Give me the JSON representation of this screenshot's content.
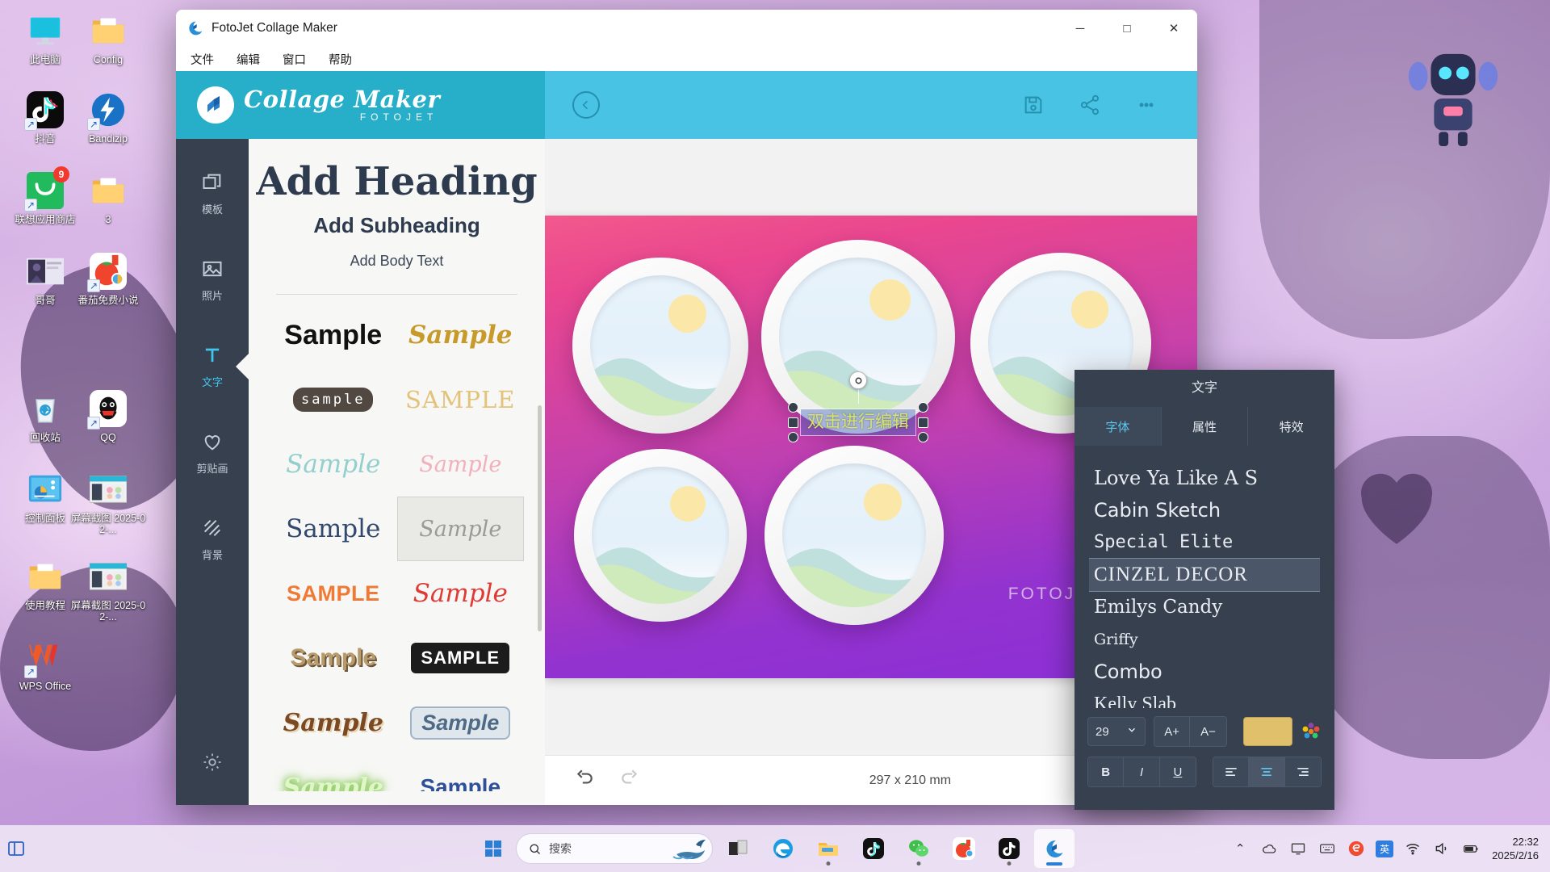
{
  "desktop": {
    "icons": [
      {
        "label": "此电脑",
        "icon": "this-pc-icon",
        "shortcut": false,
        "badge": null
      },
      {
        "label": "Config",
        "icon": "folder-icon",
        "shortcut": false,
        "badge": null
      },
      {
        "label": "抖音",
        "icon": "douyin-icon",
        "shortcut": true,
        "badge": null
      },
      {
        "label": "Bandizip",
        "icon": "bandizip-icon",
        "shortcut": true,
        "badge": null
      },
      {
        "label": "联想应用商店",
        "icon": "lenovo-store-icon",
        "shortcut": true,
        "badge": "9"
      },
      {
        "label": "3",
        "icon": "folder-icon",
        "shortcut": false,
        "badge": null
      },
      {
        "label": "哥哥",
        "icon": "image-thumb-icon",
        "shortcut": false,
        "badge": null
      },
      {
        "label": "番茄免费小说",
        "icon": "tomato-novel-icon",
        "shortcut": true,
        "badge": null
      },
      {
        "label": "回收站",
        "icon": "recycle-bin-icon",
        "shortcut": false,
        "badge": null
      },
      {
        "label": "QQ",
        "icon": "qq-icon",
        "shortcut": true,
        "badge": null
      },
      {
        "label": "控制面板",
        "icon": "control-panel-icon",
        "shortcut": false,
        "badge": null
      },
      {
        "label": "屏幕截图 2025-02-...",
        "icon": "screenshot-thumb-icon",
        "shortcut": false,
        "badge": null
      },
      {
        "label": "使用教程",
        "icon": "folder-icon",
        "shortcut": false,
        "badge": null
      },
      {
        "label": "屏幕截图 2025-02-...",
        "icon": "screenshot-thumb-icon",
        "shortcut": false,
        "badge": null
      },
      {
        "label": "WPS Office",
        "icon": "wps-office-icon",
        "shortcut": true,
        "badge": null
      }
    ]
  },
  "window": {
    "title": "FotoJet Collage Maker",
    "app_icon": "fotojet-icon",
    "controls": {
      "minimize": "─",
      "maximize": "□",
      "close": "✕"
    },
    "menu": [
      "文件",
      "编辑",
      "窗口",
      "帮助"
    ]
  },
  "brand": {
    "name": "Collage Maker",
    "sub": "FOTOJET",
    "bg_color": "#27afca"
  },
  "rail": {
    "items": [
      {
        "label": "模板",
        "icon": "templates-icon",
        "active": false
      },
      {
        "label": "照片",
        "icon": "photos-icon",
        "active": false
      },
      {
        "label": "文字",
        "icon": "text-icon",
        "active": true
      },
      {
        "label": "剪贴画",
        "icon": "clipart-heart-icon",
        "active": false
      },
      {
        "label": "背景",
        "icon": "background-icon",
        "active": false
      }
    ],
    "settings_icon": "gear-icon"
  },
  "text_panel": {
    "heading": "Add Heading",
    "subheading": "Add Subheading",
    "body": "Add Body Text",
    "samples": [
      {
        "text": "Sample",
        "style": "s-bold",
        "selected": false
      },
      {
        "text": "Sample",
        "style": "s-goldit",
        "selected": false
      },
      {
        "text": "sample",
        "style": "s-bub",
        "selected": false
      },
      {
        "text": "SAMPLE",
        "style": "s-caps",
        "selected": false
      },
      {
        "text": "Sample",
        "style": "s-mint",
        "selected": false
      },
      {
        "text": "Sample",
        "style": "s-pink",
        "selected": false
      },
      {
        "text": "Sample",
        "style": "s-navy",
        "selected": false
      },
      {
        "text": "Sample",
        "style": "s-thin",
        "selected": true
      },
      {
        "text": "SAMPLE",
        "style": "s-orange",
        "selected": false
      },
      {
        "text": "Sample",
        "style": "s-red",
        "selected": false
      },
      {
        "text": "Sample",
        "style": "s-3d",
        "selected": false
      },
      {
        "text": "SAMPLE",
        "style": "s-blk",
        "selected": false
      },
      {
        "text": "Sample",
        "style": "s-brown",
        "selected": false
      },
      {
        "text": "Sample",
        "style": "s-steel",
        "selected": false
      },
      {
        "text": "Sample",
        "style": "s-glow",
        "selected": false
      },
      {
        "text": "Sample",
        "style": "s-blue",
        "selected": false
      }
    ]
  },
  "editor": {
    "toolbar": {
      "back_icon": "back-chevron-icon",
      "save_icon": "save-floppy-icon",
      "share_icon": "share-icon",
      "more_icon": "more-dots-icon",
      "bg_color": "#49c3e4"
    },
    "canvas": {
      "watermark": "FOTOJET",
      "gradient_from": "#f2598c",
      "gradient_to": "#8b2fd6",
      "selected_text": "双击进行编辑"
    },
    "bottom": {
      "undo_icon": "undo-icon",
      "redo_icon": "redo-icon",
      "dimensions": "297 x 210 mm",
      "add_icon": "plus-icon"
    }
  },
  "float_panel": {
    "title": "文字",
    "tabs": [
      {
        "label": "字体",
        "active": true
      },
      {
        "label": "属性",
        "active": false
      },
      {
        "label": "特效",
        "active": false
      }
    ],
    "fonts": [
      {
        "name": "Love Ya Like A S",
        "selected": false
      },
      {
        "name": "Cabin Sketch",
        "selected": false
      },
      {
        "name": "Special Elite",
        "selected": false
      },
      {
        "name": "CINZEL DECOR",
        "selected": true
      },
      {
        "name": "Emilys Candy",
        "selected": false
      },
      {
        "name": "Griffy",
        "selected": false
      },
      {
        "name": "Combo",
        "selected": false
      },
      {
        "name": "Kelly Slab",
        "selected": false
      }
    ],
    "controls": {
      "font_size": "29",
      "chevron": "⌄",
      "increase": "A+",
      "decrease": "A−",
      "color_hex": "#e0c06a",
      "bold": "B",
      "italic": "I",
      "underline": "U",
      "align_left": "align-left-icon",
      "align_center": "align-center-icon",
      "align_right": "align-right-icon",
      "active_align": "center"
    }
  },
  "taskbar": {
    "search_placeholder": "搜索",
    "search_icon": "search-icon",
    "start_icon": "windows-start-icon",
    "apps": [
      {
        "name": "task-view",
        "running": false,
        "active": false
      },
      {
        "name": "edge",
        "running": false,
        "active": false
      },
      {
        "name": "file-explorer",
        "running": true,
        "active": false
      },
      {
        "name": "douyin",
        "running": false,
        "active": false
      },
      {
        "name": "wechat",
        "running": true,
        "active": false
      },
      {
        "name": "tomato-novel",
        "running": false,
        "active": false
      },
      {
        "name": "tiktok",
        "running": true,
        "active": false
      },
      {
        "name": "fotojet",
        "running": false,
        "active": true
      }
    ],
    "tray": {
      "chevron": "⌃",
      "ime": "英",
      "items": [
        "onedrive-icon",
        "display-icon",
        "keyboard-icon",
        "sogou-icon",
        "wifi-icon",
        "volume-icon",
        "battery-icon"
      ]
    },
    "clock": {
      "time": "22:32",
      "date": "2025/2/16"
    }
  }
}
